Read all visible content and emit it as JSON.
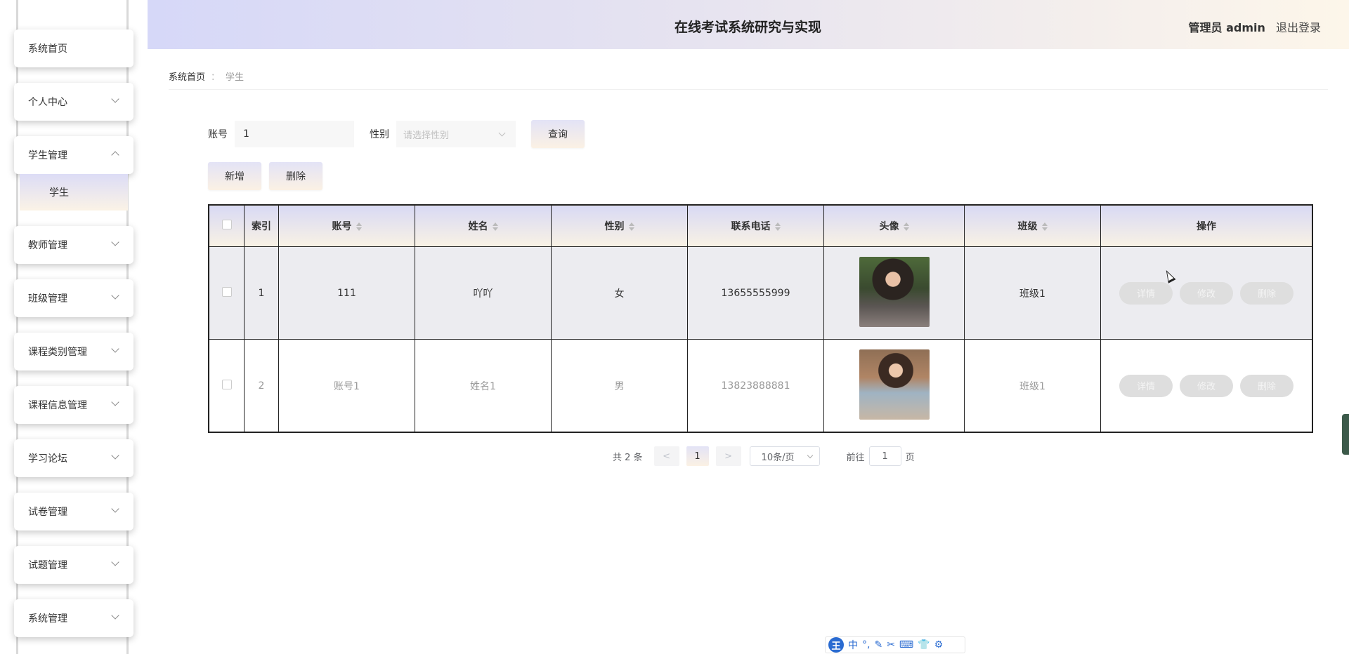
{
  "app": {
    "title": "在线考试系统研究与实现",
    "user_role": "管理员 admin",
    "logout": "退出登录"
  },
  "sidebar": {
    "items": [
      {
        "label": "系统首页"
      },
      {
        "label": "个人中心"
      },
      {
        "label": "学生管理"
      },
      {
        "label": "教师管理"
      },
      {
        "label": "班级管理"
      },
      {
        "label": "课程类别管理"
      },
      {
        "label": "课程信息管理"
      },
      {
        "label": "学习论坛"
      },
      {
        "label": "试卷管理"
      },
      {
        "label": "试题管理"
      },
      {
        "label": "系统管理"
      }
    ],
    "submenu": {
      "label": "学生"
    }
  },
  "breadcrumb": {
    "home": "系统首页",
    "sep": "：",
    "current": "学生"
  },
  "search": {
    "account_label": "账号",
    "account_value": "1",
    "gender_label": "性别",
    "gender_placeholder": "请选择性别",
    "query_button": "查询"
  },
  "actions": {
    "add": "新增",
    "delete": "删除"
  },
  "table": {
    "headers": {
      "index": "索引",
      "account": "账号",
      "name": "姓名",
      "gender": "性别",
      "phone": "联系电话",
      "avatar": "头像",
      "class": "班级",
      "ops": "操作"
    },
    "rows": [
      {
        "index": "1",
        "account": "111",
        "name": "吖吖",
        "gender": "女",
        "phone": "13655555999",
        "class": "班级1"
      },
      {
        "index": "2",
        "account": "账号1",
        "name": "姓名1",
        "gender": "男",
        "phone": "13823888881",
        "class": "班级1"
      }
    ],
    "op_labels": {
      "detail": "详情",
      "edit": "修改",
      "delete": "删除"
    }
  },
  "pagination": {
    "total": "共 2 条",
    "prev": "<",
    "current": "1",
    "next": ">",
    "page_size": "10条/页",
    "goto_label": "前往",
    "goto_value": "1",
    "page_unit": "页"
  },
  "ime": {
    "logo": "王",
    "mode": "中",
    "icons": [
      "°,",
      "✎",
      "✂",
      "⌨",
      "👕",
      "⚙"
    ]
  }
}
